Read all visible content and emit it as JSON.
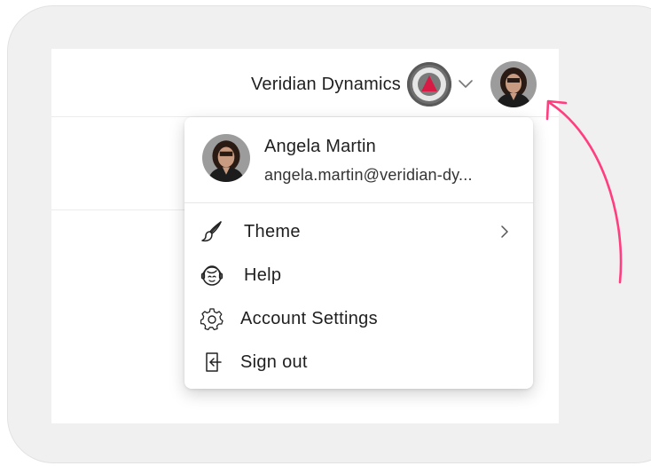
{
  "header": {
    "organization_name": "Veridian Dynamics",
    "logo_icon": "org-logo-triangle",
    "chevron_icon": "chevron-down-icon",
    "avatar_icon": "user-avatar"
  },
  "user_menu": {
    "name": "Angela Martin",
    "email": "angela.martin@veridian-dy...",
    "items": [
      {
        "label": "Theme",
        "icon": "paintbrush-icon",
        "has_submenu": true
      },
      {
        "label": "Help",
        "icon": "help-face-icon",
        "has_submenu": false
      },
      {
        "label": "Account Settings",
        "icon": "gear-icon",
        "has_submenu": false
      },
      {
        "label": "Sign out",
        "icon": "sign-out-icon",
        "has_submenu": false
      }
    ]
  },
  "colors": {
    "accent_arrow": "#ff3d7f",
    "logo_triangle": "#d81b45",
    "frame_bg": "#f0f0f0"
  }
}
